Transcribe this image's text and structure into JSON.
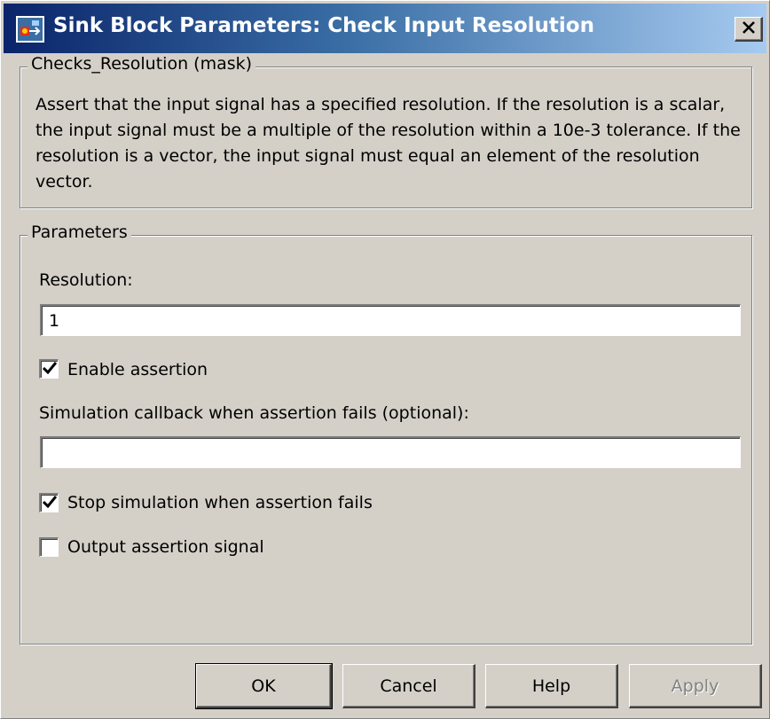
{
  "window": {
    "title": "Sink Block Parameters: Check Input Resolution",
    "icon": "simulink-block-icon",
    "close_icon": "close-x-icon"
  },
  "mask_group": {
    "legend": "Checks_Resolution (mask)",
    "description_lines": [
      "Assert that the input signal has a specified resolution.  If the resolution is a scalar,",
      "the input signal must be a multiple of the resolution within a 10e-3 tolerance.  If the",
      "resolution is a vector, the input signal must equal an element of the resolution",
      "vector."
    ]
  },
  "parameters_group": {
    "legend": "Parameters",
    "resolution_label": "Resolution:",
    "resolution_value": "1",
    "enable_assertion": {
      "label": "Enable assertion",
      "checked": true
    },
    "callback_label": "Simulation callback when assertion fails (optional):",
    "callback_value": "",
    "stop_simulation": {
      "label": "Stop simulation when assertion fails",
      "checked": true
    },
    "output_signal": {
      "label": "Output assertion signal",
      "checked": false
    }
  },
  "buttons": {
    "ok": "OK",
    "cancel": "Cancel",
    "help": "Help",
    "apply": "Apply",
    "apply_enabled": false
  },
  "colors": {
    "titlebar_start": "#0a246a",
    "titlebar_end": "#a6caf0",
    "face": "#d4d0c8"
  }
}
